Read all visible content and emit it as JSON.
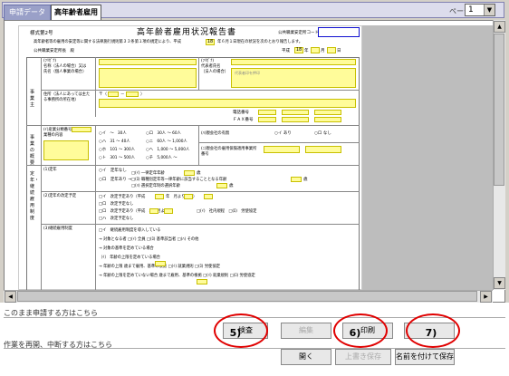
{
  "tabs": [
    {
      "label": "申請データ"
    },
    {
      "label": "高年齢者雇用"
    }
  ],
  "pager": {
    "label": "ページ",
    "value": "1"
  },
  "form": {
    "code": "様式第2号",
    "title": "高年齢者雇用状況報告書",
    "office_code_label": "公共職業安定所コード",
    "intro": "高年齢者等の雇用の安定等に関する法律施行規則第３３条第１項の規定により、平成",
    "intro_year": "18",
    "intro_tail": "年６月１日現在の状況を次のとおり報告します。",
    "to_label": "公共職業安定所長　殿",
    "date_prefix": "平成",
    "date_year": "18",
    "date_year_unit": "年",
    "date_month_unit": "月",
    "date_day_unit": "日",
    "sec_employer": "事業主",
    "row1_label": "(ﾌﾘｶﾞﾅ)\n名称（法人の場合）又は\n氏名（個人事業の場合）",
    "row1_right": "(ﾌﾘｶﾞﾅ)\n代表者氏名\n（法人の場合）",
    "row1_right_hint": "代表者印を押印",
    "addr_label": "住所（法人にあっては主たる事務所の所在地）",
    "postal_prefix": "〒（",
    "postal_dash": "－",
    "postal_close": "）",
    "tel_label": "電話番号",
    "fax_label": "ＦＡＸ番号",
    "sec_office": "事業の概要",
    "o1": "(ｲ)産業分類番号",
    "o1b": "業種の内容",
    "o2_items": [
      "○イ　～　30人",
      "○ハ　31 ～ 40人",
      "○ホ　101 ～ 300人",
      "○ト　301 ～ 500人"
    ],
    "o2_items_r": [
      "○ロ　30人 ～ 60人",
      "○ニ　60人 ～ 1,000人",
      "○ヘ　1,000 ～ 5,000人",
      "○チ　5,000人 ～"
    ],
    "o3": "(ﾊ)親会社の有無",
    "o3_opts": [
      "○イ あり",
      "○ロ なし"
    ],
    "o4": "(ﾆ)親会社の雇用保険適用事業所番号",
    "sec_retire": "定年・継続雇用制度",
    "r1": "(1)定年",
    "r1_opts": [
      "○イ　定年なし",
      "○ロ　定年あり →"
    ],
    "r1_sub": [
      "□(ｲ) 一律定年年齢",
      "□(ﾛ) 職種別定年等一律年齢に該当することとなる年齢",
      "□(ﾊ) 選択定年制の選択年齢"
    ],
    "age_unit": "歳",
    "r2": "(2)定年の改定予定",
    "r2_opts": [
      "□イ　改定予定あり（平成",
      "□ロ　改定予定なし"
    ],
    "r2_tail": "年　月より　歳）",
    "r3_opts": [
      "□ロ　改定予定あり（平成　年　月より）",
      "□ハ　改定予定なし"
    ],
    "r3_sub": "□(ｲ)　社内規程　□(ﾛ)　労使協定",
    "r4": "(3)継続雇用制度",
    "r4_lines": [
      "□イ　継続雇用制度を導入している",
      "→ 対象となる者 □(ｲ) 全員 □(ﾛ) 基準該当者 □(ﾊ) その他",
      "→ 対象の基準を定めている場合",
      "（ｲ） 年齢の上限を定めている場合",
      "→ 年齢の上限 歳まで雇用、基準の根拠 □(ｲ) 就業規則 □(ﾛ) 労使協定",
      "→ 年齢の上限を定めていない場合 歳まで雇用、基準の根拠 □(ｲ) 就業規則 □(ﾛ) 労使協定"
    ]
  },
  "bottom": {
    "label_apply": "このまま申請する方はこちら",
    "label_resume": "作業を再開、中断する方はこちら",
    "btn_check": "検査",
    "btn_edit": "編集",
    "btn_print": "印刷",
    "btn_open": "開く",
    "btn_overwrite": "上書き保存",
    "btn_saveas": "名前を付けて保存",
    "mark5": "5)",
    "mark6": "6)",
    "mark7": "7)"
  }
}
